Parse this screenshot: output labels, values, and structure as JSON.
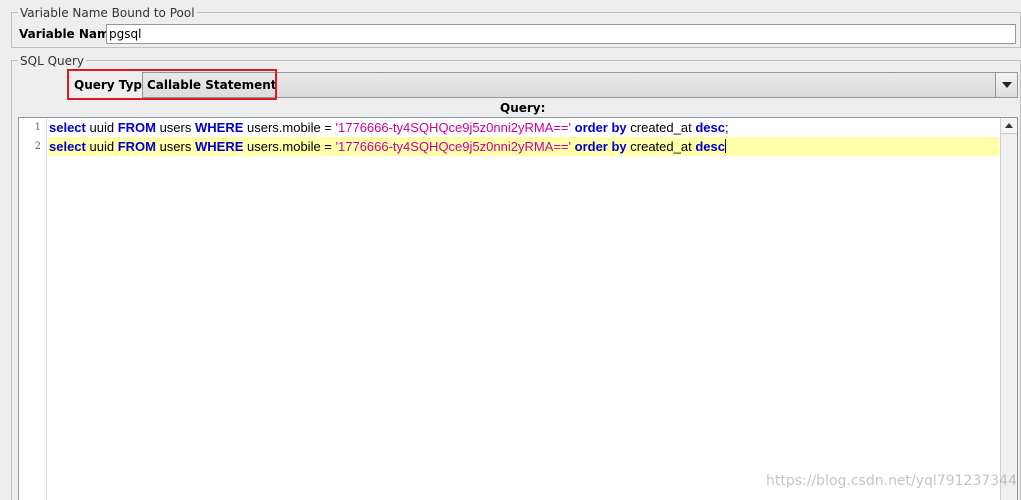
{
  "variable_group": {
    "title": "Variable Name Bound to Pool",
    "label": "Variable Name:",
    "value": "pgsql"
  },
  "sql_group": {
    "title": "SQL Query",
    "query_type_label": "Query Type:",
    "query_type_value": "Callable Statement",
    "query_label": "Query:"
  },
  "editor": {
    "line_numbers": [
      "1",
      "2"
    ],
    "lines": [
      {
        "tokens": [
          {
            "t": "select",
            "c": "kw"
          },
          {
            "t": " uuid ",
            "c": "id"
          },
          {
            "t": "FROM",
            "c": "kw"
          },
          {
            "t": " users ",
            "c": "id"
          },
          {
            "t": "WHERE",
            "c": "kw"
          },
          {
            "t": " users.mobile ",
            "c": "id"
          },
          {
            "t": "= ",
            "c": "op"
          },
          {
            "t": "'1776666-ty4SQHQce9j5z0nni2yRMA=='",
            "c": "str"
          },
          {
            "t": " ",
            "c": "id"
          },
          {
            "t": "order by",
            "c": "kw"
          },
          {
            "t": " created_at ",
            "c": "id"
          },
          {
            "t": "desc",
            "c": "kw"
          },
          {
            "t": ";",
            "c": "op"
          }
        ]
      },
      {
        "tokens": [
          {
            "t": "select",
            "c": "kw"
          },
          {
            "t": " uuid ",
            "c": "id"
          },
          {
            "t": "FROM",
            "c": "kw"
          },
          {
            "t": " users ",
            "c": "id"
          },
          {
            "t": "WHERE",
            "c": "kw"
          },
          {
            "t": " users.mobile ",
            "c": "id"
          },
          {
            "t": "= ",
            "c": "op"
          },
          {
            "t": "'1776666-ty4SQHQce9j5z0nni2yRMA=='",
            "c": "str"
          },
          {
            "t": " ",
            "c": "id"
          },
          {
            "t": "order by",
            "c": "kw"
          },
          {
            "t": " created_at ",
            "c": "id"
          },
          {
            "t": "desc",
            "c": "kw"
          }
        ]
      }
    ]
  },
  "colors": {
    "keyword": "#0000cc",
    "string": "#cc0099",
    "current_line": "#ffffaa",
    "highlight_box": "#e0191f"
  },
  "icons": {
    "dropdown": "chevron-down-icon",
    "scroll_up": "scroll-up-arrow-icon"
  },
  "watermark": "https://blog.csdn.net/yql791237344"
}
